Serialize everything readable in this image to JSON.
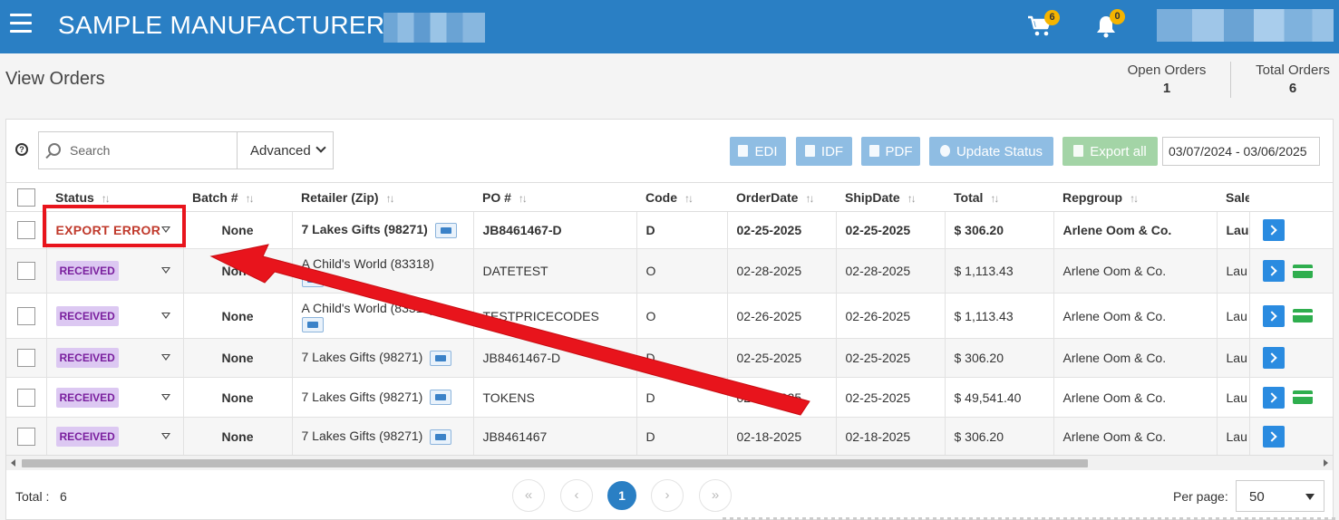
{
  "header": {
    "app_title": "SAMPLE MANUFACTURER -",
    "cart_count": "6",
    "notification_count": "0"
  },
  "page": {
    "title": "View Orders",
    "open_orders_label": "Open Orders",
    "open_orders_value": "1",
    "total_orders_label": "Total Orders",
    "total_orders_value": "6"
  },
  "toolbar": {
    "help": "?",
    "search_placeholder": "Search",
    "advanced_label": "Advanced",
    "edi_label": "EDI",
    "idf_label": "IDF",
    "pdf_label": "PDF",
    "update_status_label": "Update Status",
    "export_all_label": "Export all",
    "date_range": "03/07/2024 - 03/06/2025"
  },
  "table": {
    "columns": [
      "Status",
      "Batch #",
      "Retailer (Zip)",
      "PO #",
      "Code",
      "OrderDate",
      "ShipDate",
      "Total",
      "Repgroup",
      "Sale"
    ],
    "rows": [
      {
        "status": "EXPORT ERROR",
        "batch": "None",
        "retailer": "7 Lakes Gifts (98271)",
        "po": "JB8461467-D",
        "code": "D",
        "order_date": "02-25-2025",
        "ship_date": "02-25-2025",
        "total": "$ 306.20",
        "repgroup": "Arlene Oom & Co.",
        "sale": "Lau"
      },
      {
        "status": "RECEIVED",
        "batch": "None",
        "retailer": "A Child's World (83318)",
        "po": "DATETEST",
        "code": "O",
        "order_date": "02-28-2025",
        "ship_date": "02-28-2025",
        "total": "$ 1,113.43",
        "repgroup": "Arlene Oom & Co.",
        "sale": "Lau"
      },
      {
        "status": "RECEIVED",
        "batch": "None",
        "retailer": "A Child's World (83318)",
        "po": "TESTPRICECODES",
        "code": "O",
        "order_date": "02-26-2025",
        "ship_date": "02-26-2025",
        "total": "$ 1,113.43",
        "repgroup": "Arlene Oom & Co.",
        "sale": "Lau"
      },
      {
        "status": "RECEIVED",
        "batch": "None",
        "retailer": "7 Lakes Gifts (98271)",
        "po": "JB8461467-D",
        "code": "D",
        "order_date": "02-25-2025",
        "ship_date": "02-25-2025",
        "total": "$ 306.20",
        "repgroup": "Arlene Oom & Co.",
        "sale": "Lau"
      },
      {
        "status": "RECEIVED",
        "batch": "None",
        "retailer": "7 Lakes Gifts (98271)",
        "po": "TOKENS",
        "code": "D",
        "order_date": "02-25-2025",
        "ship_date": "02-25-2025",
        "total": "$ 49,541.40",
        "repgroup": "Arlene Oom & Co.",
        "sale": "Lau"
      },
      {
        "status": "RECEIVED",
        "batch": "None",
        "retailer": "7 Lakes Gifts (98271)",
        "po": "JB8461467",
        "code": "D",
        "order_date": "02-18-2025",
        "ship_date": "02-18-2025",
        "total": "$ 306.20",
        "repgroup": "Arlene Oom & Co.",
        "sale": "Lau"
      }
    ]
  },
  "footer": {
    "total_label": "Total :",
    "total_value": "6",
    "first_page": "«",
    "prev_page": "‹",
    "current_page": "1",
    "next_page": "›",
    "last_page": "»",
    "per_page_label": "Per page:",
    "per_page_value": "50"
  },
  "colors": {
    "header_bg": "#2a7fc4",
    "badge": "#f5b400",
    "status_received_bg": "#dcc8f2",
    "status_received_text": "#7a1f9e",
    "status_error_text": "#c0392b",
    "annotation_red": "#e8141c"
  }
}
